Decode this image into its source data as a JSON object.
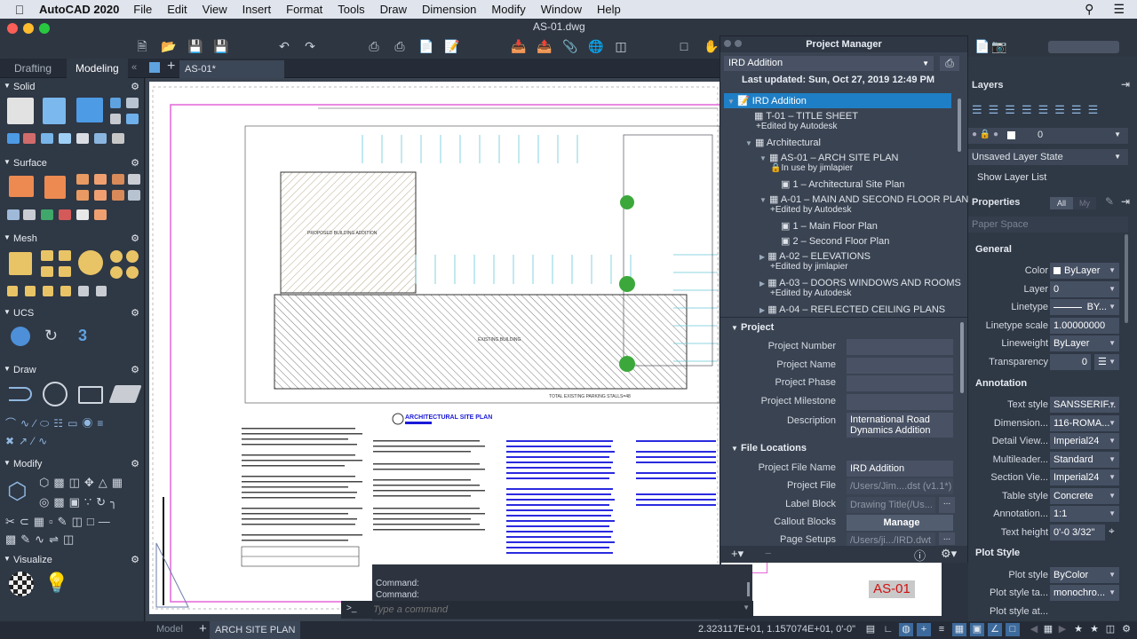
{
  "menubar": {
    "app": "AutoCAD 2020",
    "items": [
      "File",
      "Edit",
      "View",
      "Insert",
      "Format",
      "Tools",
      "Draw",
      "Dimension",
      "Modify",
      "Window",
      "Help"
    ]
  },
  "window": {
    "title": "AS-01.dwg"
  },
  "workspace_tabs": [
    "Drafting",
    "Modeling"
  ],
  "file_tab": "AS-01*",
  "palette": {
    "sections": [
      {
        "label": "Solid"
      },
      {
        "label": "Surface"
      },
      {
        "label": "Mesh"
      },
      {
        "label": "UCS"
      },
      {
        "label": "Draw"
      },
      {
        "label": "Modify"
      },
      {
        "label": "Visualize"
      }
    ]
  },
  "drawing": {
    "title": "ARCHITECTURAL SITE PLAN",
    "proposed_label": "PROPOSED BUILDING ADDITION",
    "existing_label": "EXISTING BUILDING",
    "parking_total": "TOTAL EXISTING PARKING STALLS=48",
    "sheet_number": "AS-01"
  },
  "project_manager": {
    "title": "Project Manager",
    "project_select": "IRD Addition",
    "last_updated": "Last updated: Sun, Oct 27, 2019 12:49 PM",
    "tree": [
      {
        "label": "IRD Addition",
        "sub": "",
        "level": 0,
        "selected": true
      },
      {
        "label": "T-01 – TITLE SHEET",
        "sub": "Edited by Autodesk",
        "level": 1
      },
      {
        "label": "Architectural",
        "sub": "",
        "level": 1
      },
      {
        "label": "AS-01 – ARCH SITE PLAN",
        "sub": "In use by jimlapier",
        "level": 2
      },
      {
        "label": "1 – Architectural Site Plan",
        "sub": "",
        "level": 3
      },
      {
        "label": "A-01 – MAIN AND SECOND FLOOR PLAN",
        "sub": "Edited by Autodesk",
        "level": 2
      },
      {
        "label": "1 – Main Floor Plan",
        "sub": "",
        "level": 3
      },
      {
        "label": "2 – Second Floor Plan",
        "sub": "",
        "level": 3
      },
      {
        "label": "A-02 – ELEVATIONS",
        "sub": "Edited by jimlapier",
        "level": 2
      },
      {
        "label": "A-03 – DOORS WINDOWS AND ROOMS",
        "sub": "Edited by Autodesk",
        "level": 2
      },
      {
        "label": "A-04 – REFLECTED CEILING PLANS",
        "sub": "",
        "level": 2
      }
    ],
    "project_section": "Project",
    "project_fields": [
      {
        "label": "Project Number",
        "value": ""
      },
      {
        "label": "Project Name",
        "value": ""
      },
      {
        "label": "Project Phase",
        "value": ""
      },
      {
        "label": "Project Milestone",
        "value": ""
      },
      {
        "label": "Description",
        "value": "International Road Dynamics Addition"
      }
    ],
    "file_section": "File Locations",
    "file_fields": [
      {
        "label": "Project File Name",
        "value": "IRD Addition"
      },
      {
        "label": "Project File",
        "value": "/Users/Jim....dst (v1.1*)"
      },
      {
        "label": "Label Block",
        "value": "Drawing Title(/Us..."
      },
      {
        "label": "Callout Blocks",
        "value": "Manage"
      },
      {
        "label": "Page Setups",
        "value": "/Users/ji.../IRD.dwt"
      }
    ],
    "browse_label": "..."
  },
  "layers": {
    "title": "Layers",
    "current_layer": "0",
    "layer_state": "Unsaved Layer State",
    "show_list": "Show Layer List"
  },
  "properties": {
    "title": "Properties",
    "filter_all": "All",
    "filter_my": "My",
    "space": "Paper Space",
    "general_title": "General",
    "general": [
      {
        "label": "Color",
        "value": "ByLayer"
      },
      {
        "label": "Layer",
        "value": "0"
      },
      {
        "label": "Linetype",
        "value": "BY..."
      },
      {
        "label": "Linetype scale",
        "value": "1.00000000"
      },
      {
        "label": "Lineweight",
        "value": "ByLayer"
      },
      {
        "label": "Transparency",
        "value": "0"
      }
    ],
    "annotation_title": "Annotation",
    "annotation": [
      {
        "label": "Text style",
        "value": "SANSSERIF..."
      },
      {
        "label": "Dimension...",
        "value": "116-ROMA..."
      },
      {
        "label": "Detail View...",
        "value": "Imperial24"
      },
      {
        "label": "Multileader...",
        "value": "Standard"
      },
      {
        "label": "Section Vie...",
        "value": "Imperial24"
      },
      {
        "label": "Table style",
        "value": "Concrete"
      },
      {
        "label": "Annotation...",
        "value": "1:1"
      },
      {
        "label": "Text height",
        "value": "0'-0 3/32\""
      }
    ],
    "plot_title": "Plot Style",
    "plot": [
      {
        "label": "Plot style",
        "value": "ByColor"
      },
      {
        "label": "Plot style ta...",
        "value": "monochro..."
      },
      {
        "label": "Plot style at...",
        "value": ""
      }
    ]
  },
  "command": {
    "history": [
      "Command:",
      "Command:"
    ],
    "placeholder": "Type a command",
    "prompt": ">_"
  },
  "status": {
    "model_tab": "Model",
    "layout_tab": "ARCH SITE PLAN",
    "coords": "2.323117E+01, 1.157074E+01, 0'-0\""
  }
}
